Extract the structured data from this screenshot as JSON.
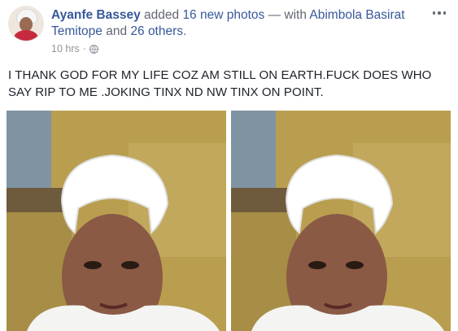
{
  "post": {
    "author": "Ayanfe Bassey",
    "action_text": " added ",
    "photos_link": "16 new photos",
    "with_text": " — with ",
    "tagged_name": "Abimbola Basirat Temitope",
    "and_text": " and ",
    "others_link": "26 others",
    "period": ".",
    "timestamp": "10 hrs",
    "separator": "·",
    "privacy_icon": "globe-icon",
    "more_icon": "more-options-icon",
    "body": "I THANK GOD FOR MY LIFE COZ AM STILL ON EARTH.FUCK DOES WHO SAY RIP TO ME .JOKING TINX ND NW TINX ON POINT."
  },
  "colors": {
    "link": "#365899",
    "text": "#1d2129",
    "meta": "#90949c",
    "wall": "#b99e50",
    "cap": "#ffffff",
    "outfit": "#f4f4f2"
  }
}
